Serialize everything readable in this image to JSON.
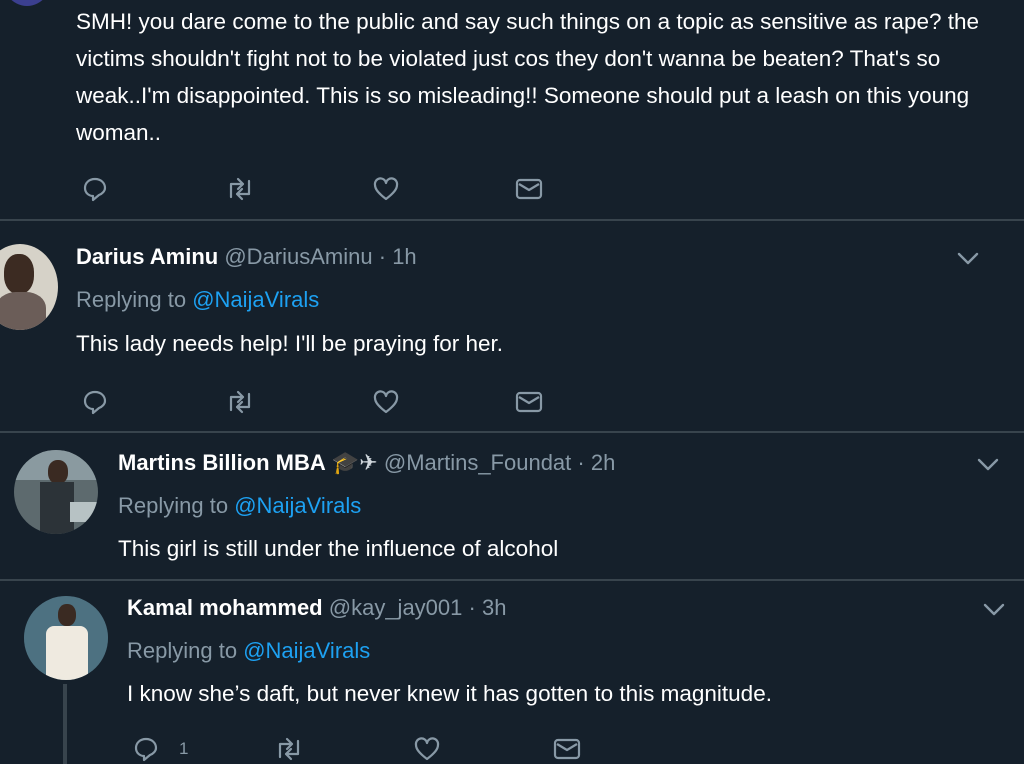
{
  "tweets": [
    {
      "body": "SMH! you dare come to the public and say such things on a topic as sensitive as rape? the victims shouldn't fight not to be violated just cos they don't wanna be beaten? That's so weak..I'm disappointed. This is so misleading!! Someone should put a leash on this young woman.."
    },
    {
      "name": "Darius Aminu",
      "handle": "@DariusAminu",
      "separator": "·",
      "time": "1h",
      "replying_prefix": "Replying to ",
      "replying_to": "@NaijaVirals",
      "body": "This lady needs help! I'll be praying for her."
    },
    {
      "name": "Martins Billion MBA",
      "name_emoji": "🎓✈",
      "handle": "@Martins_Foundat",
      "separator": "·",
      "time": "2h",
      "replying_prefix": "Replying to ",
      "replying_to": "@NaijaVirals",
      "body": "This girl is still under the influence of alcohol"
    },
    {
      "name": "Kamal mohammed",
      "handle": "@kay_jay001",
      "separator": "·",
      "time": "3h",
      "replying_prefix": "Replying to ",
      "replying_to": "@NaijaVirals",
      "body": "I know she’s daft, but never knew it has gotten to this magnitude.",
      "reply_count": "1"
    }
  ],
  "colors": {
    "background": "#15202b",
    "divider": "#38444d",
    "muted_text": "#8899a6",
    "link": "#1da1f2"
  },
  "icons": [
    "reply-icon",
    "retweet-icon",
    "like-icon",
    "dm-icon",
    "chevron-down-icon"
  ]
}
